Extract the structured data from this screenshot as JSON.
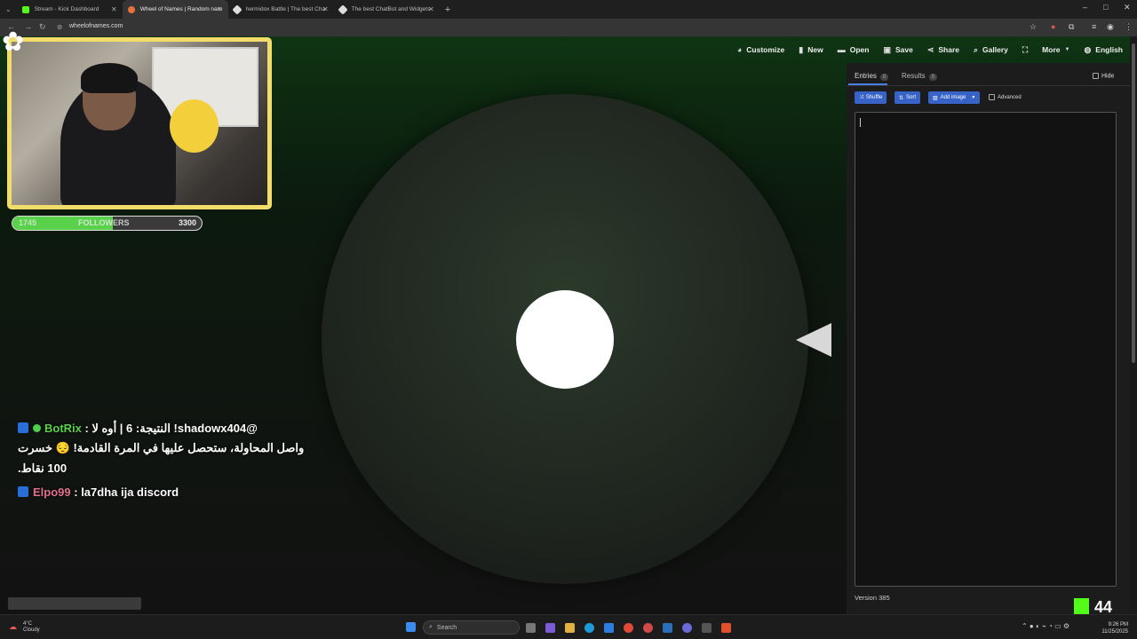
{
  "browser": {
    "tabs": [
      {
        "label": "Stream - Kick Dashboard",
        "color": "#53fc18"
      },
      {
        "label": "Wheel of Names | Random nam",
        "color": "#e8703a"
      },
      {
        "label": "hermidox Battle | The best Cha",
        "color": "#dddddd"
      },
      {
        "label": "The best ChatBot and Widgets",
        "color": "#dddddd"
      }
    ],
    "url": "wheelofnames.com"
  },
  "nav": {
    "customize": "Customize",
    "new": "New",
    "open": "Open",
    "save": "Save",
    "share": "Share",
    "gallery": "Gallery",
    "more": "More",
    "language": "English"
  },
  "panel": {
    "entries_tab": "Entries",
    "entries_count": "0",
    "results_tab": "Results",
    "results_count": "0",
    "hide_label": "Hide",
    "shuffle": "Shuffle",
    "sort": "Sort",
    "add_image": "Add image",
    "advanced": "Advanced",
    "version": "Version 385"
  },
  "overlay": {
    "followers_current": "1745",
    "followers_label": "FOLLOWERS",
    "followers_goal": "3300",
    "followers_progress": 0.53,
    "chat": [
      {
        "user": "BotRix",
        "user_color": "#5ad14a",
        "text": "@shadowx404! النتيجة: 6 | أوه لا :"
      },
      {
        "text": "واصل المحاولة، ستحصل عليها في المرة القادمة! 😔 خسرت"
      },
      {
        "text": "100 نقاط."
      },
      {
        "user": "Elpo99",
        "user_color": "#e0708a",
        "text": ": la7dha ija discord"
      }
    ],
    "kick_viewers": "44"
  },
  "taskbar": {
    "temp": "4°C",
    "weather": "Cloudy",
    "search": "Search",
    "time": "9:26 PM",
    "date": "11/25/2025"
  }
}
